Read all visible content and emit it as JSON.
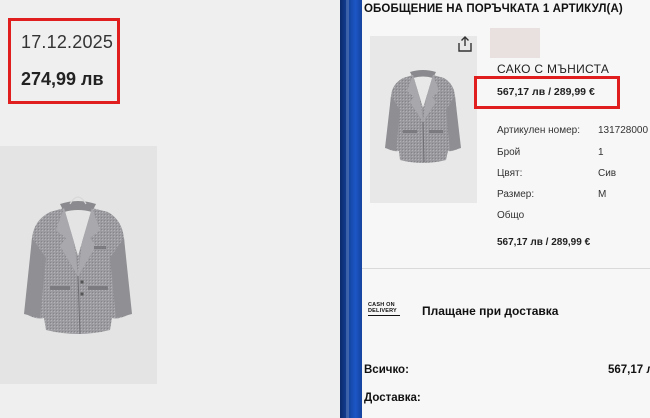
{
  "left_panel": {
    "date": "17.12.2025",
    "price": "274,99 лв"
  },
  "right_panel": {
    "summary_title": "ОБОБЩЕНИЕ НА ПОРЪЧКАТА 1 АРТИКУЛ(А)",
    "product_name": "САКО С МЪНИСТА",
    "price_highlight": "567,17 лв / 289,99 €",
    "details": [
      {
        "label": "Артикулен номер:",
        "value": "131728000"
      },
      {
        "label": "Брой",
        "value": "1"
      },
      {
        "label": "Цвят:",
        "value": "Сив"
      },
      {
        "label": "Размер:",
        "value": "M"
      },
      {
        "label": "Общо",
        "value": ""
      }
    ],
    "total_price": "567,17 лв / 289,99 €",
    "cod_badge": {
      "line1": "CASH ON",
      "line2": "DELIVERY"
    },
    "payment_method": "Плащане при доставка",
    "sum_label": "Всичко:",
    "sum_value": "567,17 л",
    "delivery_label": "Доставка:"
  },
  "colors": {
    "highlight_red": "#e01e1e",
    "divider_blue": "#1c57c6",
    "jacket_grey": "#9a9a9c"
  }
}
